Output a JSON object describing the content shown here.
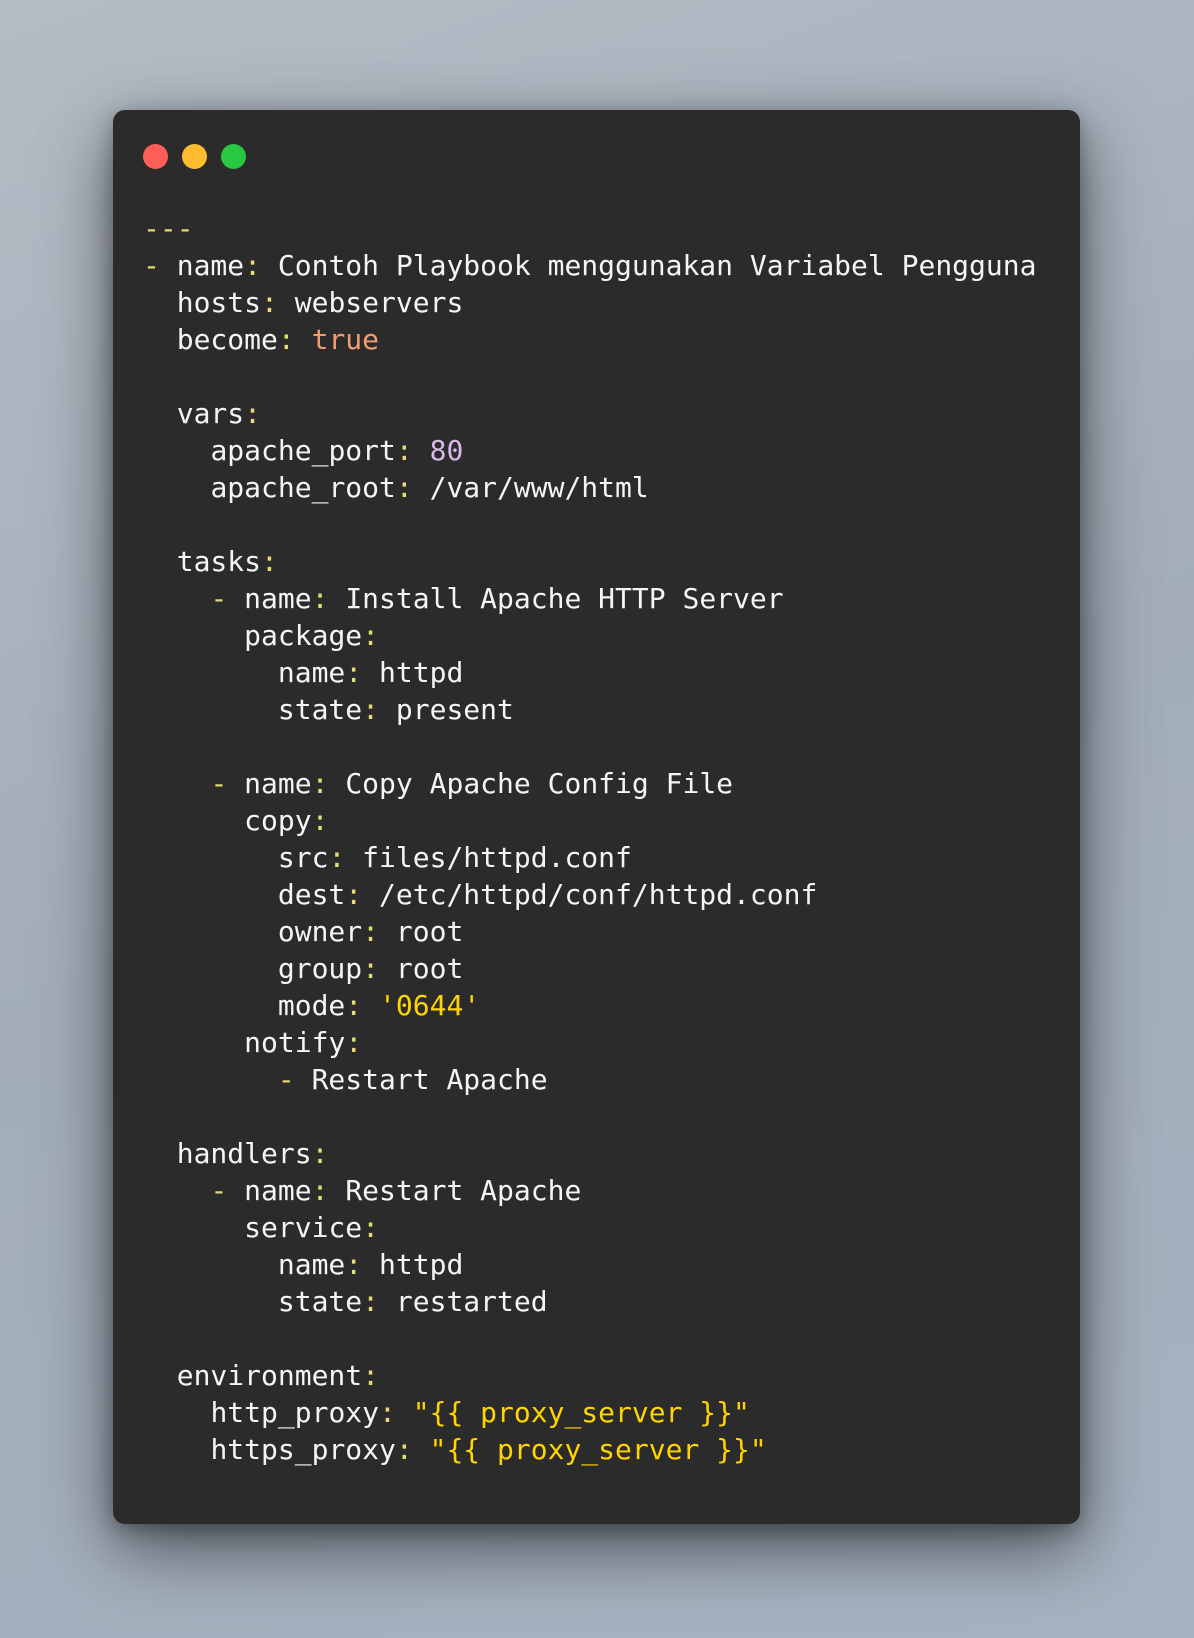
{
  "window": {
    "controls": [
      "close",
      "minimize",
      "maximize"
    ]
  },
  "code": {
    "l01": "---",
    "l02_dash": "- ",
    "l02_key": "name",
    "l02_val": "Contoh Playbook menggunakan Variabel Pengguna",
    "l03_key": "hosts",
    "l03_val": "webservers",
    "l04_key": "become",
    "l04_val": "true",
    "l06_key": "vars",
    "l07_key": "apache_port",
    "l07_val": "80",
    "l08_key": "apache_root",
    "l08_val": "/var/www/html",
    "l10_key": "tasks",
    "l11_key": "name",
    "l11_val": "Install Apache HTTP Server",
    "l12_key": "package",
    "l13_key": "name",
    "l13_val": "httpd",
    "l14_key": "state",
    "l14_val": "present",
    "l16_key": "name",
    "l16_val": "Copy Apache Config File",
    "l17_key": "copy",
    "l18_key": "src",
    "l18_val": "files/httpd.conf",
    "l19_key": "dest",
    "l19_val": "/etc/httpd/conf/httpd.conf",
    "l20_key": "owner",
    "l20_val": "root",
    "l21_key": "group",
    "l21_val": "root",
    "l22_key": "mode",
    "l22_val": "'0644'",
    "l23_key": "notify",
    "l24_val": "Restart Apache",
    "l26_key": "handlers",
    "l27_key": "name",
    "l27_val": "Restart Apache",
    "l28_key": "service",
    "l29_key": "name",
    "l29_val": "httpd",
    "l30_key": "state",
    "l30_val": "restarted",
    "l32_key": "environment",
    "l33_key": "http_proxy",
    "l33_val": "\"{{ proxy_server }}\"",
    "l34_key": "https_proxy",
    "l34_val": "\"{{ proxy_server }}\""
  },
  "colors": {
    "background": "#2b2b2b",
    "punctuation": "#e6db74",
    "string": "#ffd400",
    "boolean": "#f29c73",
    "number": "#d7b8e8",
    "text": "#f5f5f5"
  }
}
